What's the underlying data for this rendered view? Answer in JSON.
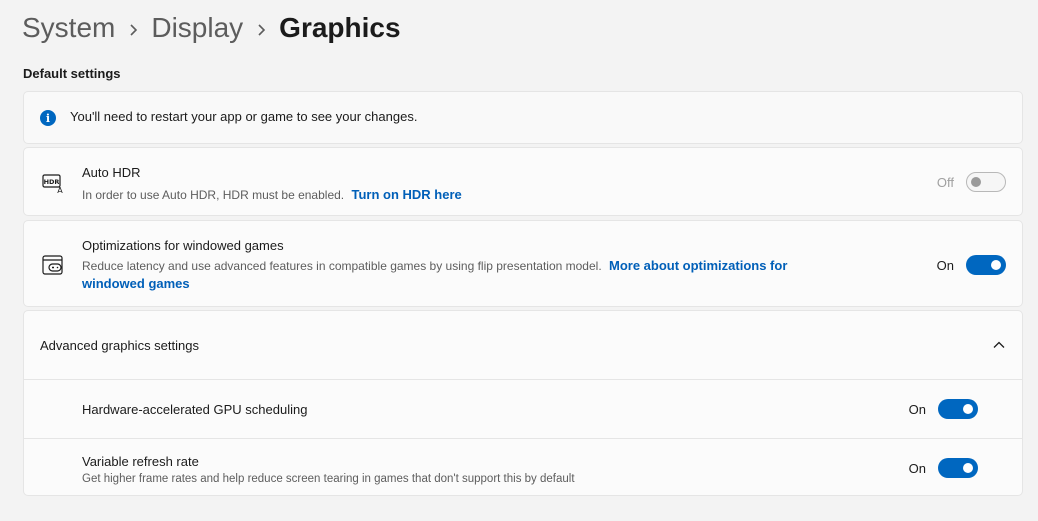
{
  "breadcrumb": {
    "items": [
      "System",
      "Display"
    ],
    "current": "Graphics"
  },
  "section_title": "Default settings",
  "info_banner": {
    "icon": "info-icon",
    "text": "You'll need to restart your app or game to see your changes."
  },
  "auto_hdr": {
    "icon": "hdr-icon",
    "title": "Auto HDR",
    "description": "In order to use Auto HDR, HDR must be enabled.",
    "link": "Turn on HDR here",
    "state_label": "Off",
    "enabled": false
  },
  "windowed_games": {
    "icon": "gamepad-window-icon",
    "title": "Optimizations for windowed games",
    "description": "Reduce latency and use advanced features in compatible games by using flip presentation model.",
    "link_part1": "More about optimizations for",
    "link_part2": "windowed games",
    "state_label": "On",
    "enabled": true
  },
  "advanced": {
    "title": "Advanced graphics settings",
    "expanded": true,
    "gpu_scheduling": {
      "title": "Hardware-accelerated GPU scheduling",
      "state_label": "On",
      "enabled": true
    },
    "vrr": {
      "title": "Variable refresh rate",
      "description": "Get higher frame rates and help reduce screen tearing in games that don't support this by default",
      "state_label": "On",
      "enabled": true
    }
  },
  "colors": {
    "accent": "#0067c0",
    "link": "#005fb8",
    "background": "#f3f3f3",
    "card": "#fbfbfb"
  }
}
